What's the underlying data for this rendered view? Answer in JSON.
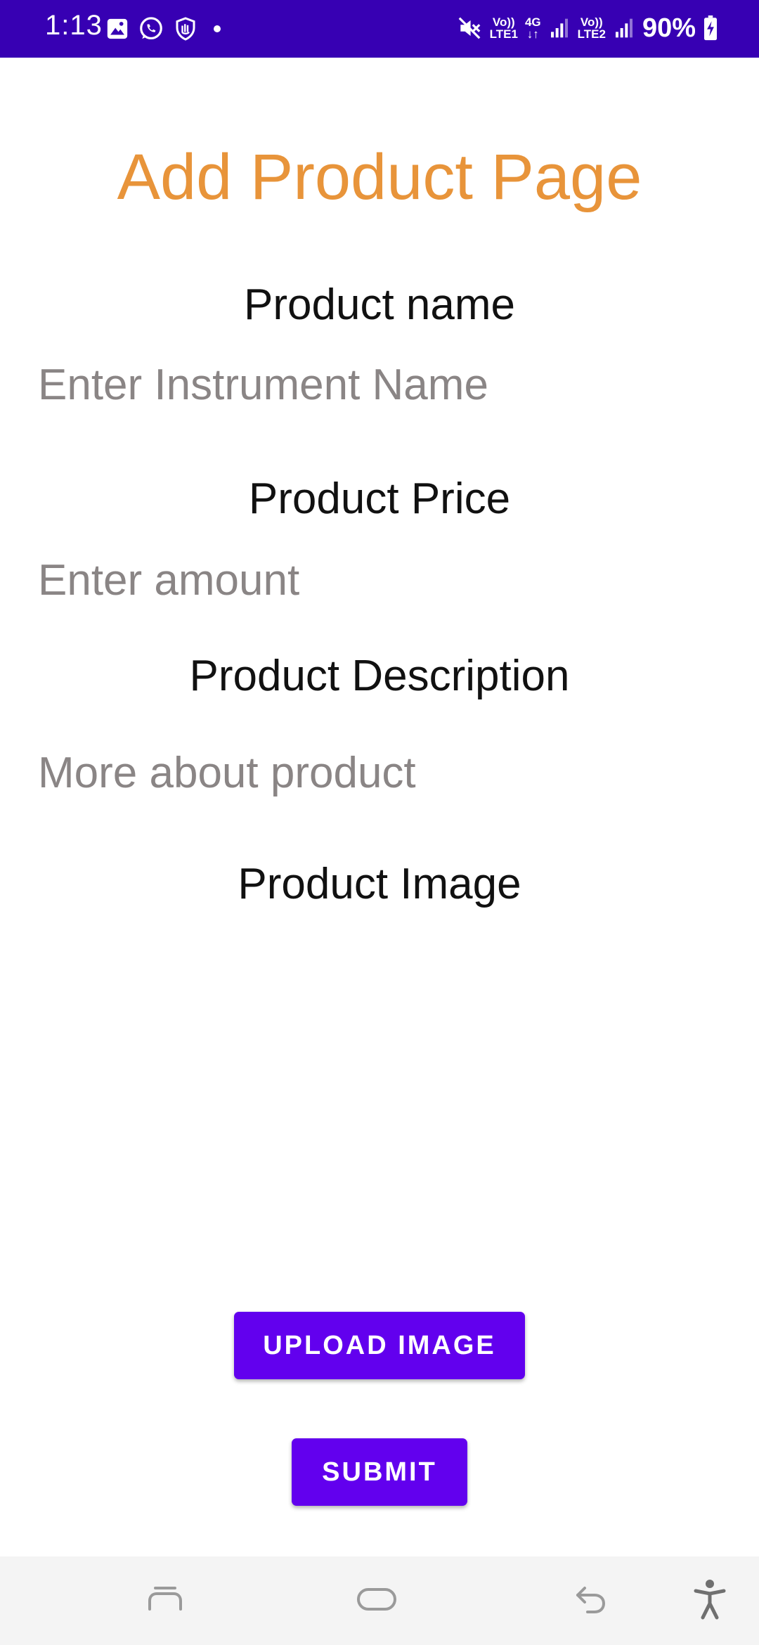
{
  "status_bar": {
    "time": "1:13",
    "battery": "90%",
    "network1_top": "Vo))",
    "network1_bottom": "LTE1",
    "network_type": "4G",
    "network2_top": "Vo))",
    "network2_bottom": "LTE2",
    "background_color": "#3700b3"
  },
  "page": {
    "title": "Add Product Page",
    "title_color": "#e8943a"
  },
  "form": {
    "name_label": "Product name",
    "name_placeholder": "Enter Instrument Name",
    "price_label": "Product Price",
    "price_placeholder": "Enter amount",
    "description_label": "Product Description",
    "description_placeholder": "More about product",
    "image_label": "Product Image"
  },
  "actions": {
    "upload_label": "UPLOAD IMAGE",
    "submit_label": "SUBMIT",
    "button_color": "#6200ee"
  },
  "nav_bar": {
    "recents_icon": "recents-icon",
    "home_icon": "home-icon",
    "back_icon": "back-icon",
    "accessibility_icon": "accessibility-icon"
  }
}
